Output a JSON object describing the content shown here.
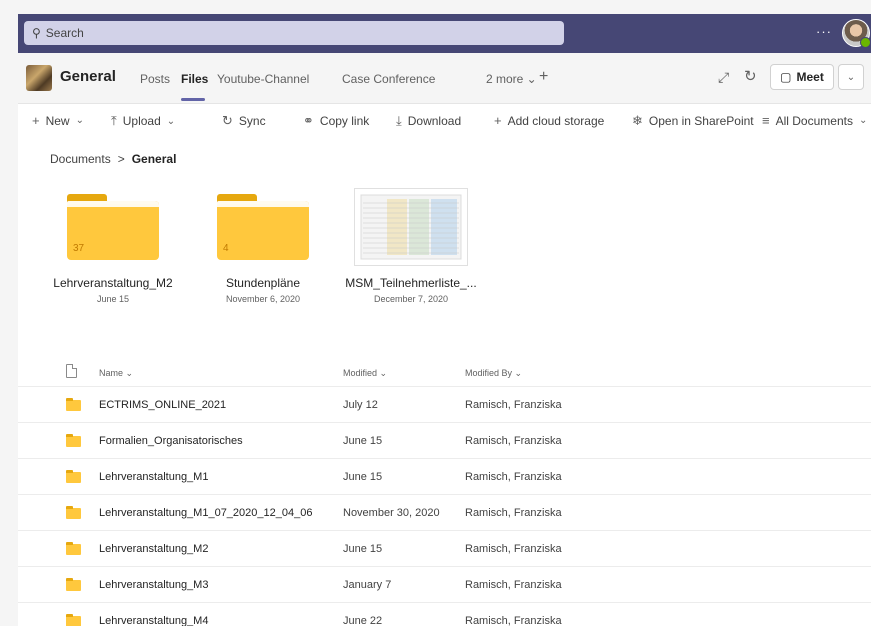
{
  "topbar": {
    "search_placeholder": "Search",
    "more_label": "···"
  },
  "channel": {
    "name": "General",
    "tabs": [
      {
        "label": "Posts"
      },
      {
        "label": "Files"
      },
      {
        "label": "Youtube-Channel"
      },
      {
        "label": "Case Conference"
      },
      {
        "label": "2 more ⌄"
      }
    ],
    "add_tab": "+",
    "meet_label": "Meet"
  },
  "commands": {
    "new": "New",
    "upload": "Upload",
    "sync": "Sync",
    "copy_link": "Copy link",
    "download": "Download",
    "add_cloud": "Add cloud storage",
    "open_sharepoint": "Open in SharePoint",
    "all_documents": "All Documents"
  },
  "breadcrumb": {
    "root": "Documents",
    "separator": ">",
    "current": "General"
  },
  "tiles": [
    {
      "name": "Lehrveranstaltung_M2",
      "date": "June 15",
      "count": "37",
      "kind": "folder"
    },
    {
      "name": "Stundenpläne",
      "date": "November 6, 2020",
      "count": "4",
      "kind": "folder"
    },
    {
      "name": "MSM_Teilnehmerliste_...",
      "date": "December 7, 2020",
      "count": "",
      "kind": "spreadsheet"
    }
  ],
  "list": {
    "columns": {
      "name": "Name ⌄",
      "modified": "Modified ⌄",
      "modified_by": "Modified By ⌄"
    },
    "rows": [
      {
        "name": "ECTRIMS_ONLINE_2021",
        "modified": "July 12",
        "modified_by": "Ramisch, Franziska"
      },
      {
        "name": "Formalien_Organisatorisches",
        "modified": "June 15",
        "modified_by": "Ramisch, Franziska"
      },
      {
        "name": "Lehrveranstaltung_M1",
        "modified": "June 15",
        "modified_by": "Ramisch, Franziska"
      },
      {
        "name": "Lehrveranstaltung_M1_07_2020_12_04_06",
        "modified": "November 30, 2020",
        "modified_by": "Ramisch, Franziska"
      },
      {
        "name": "Lehrveranstaltung_M2",
        "modified": "June 15",
        "modified_by": "Ramisch, Franziska"
      },
      {
        "name": "Lehrveranstaltung_M3",
        "modified": "January 7",
        "modified_by": "Ramisch, Franziska"
      },
      {
        "name": "Lehrveranstaltung_M4",
        "modified": "June 22",
        "modified_by": "Ramisch, Franziska"
      }
    ]
  },
  "colors": {
    "topbar": "#464775",
    "accent": "#6264a7",
    "folder": "#ffc83d"
  }
}
